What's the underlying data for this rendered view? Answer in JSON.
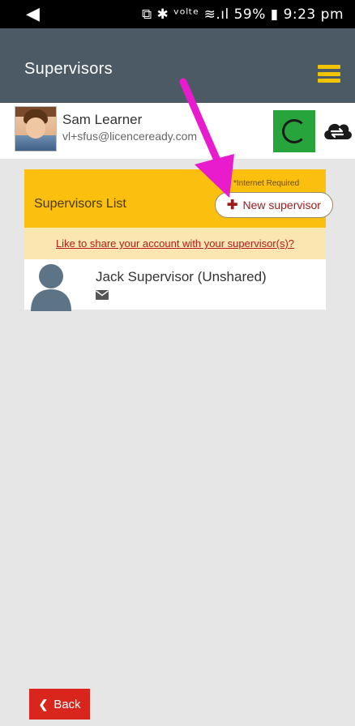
{
  "status_bar": {
    "back_glyph": "◀",
    "text": "⧉ ✱ ᵛᵒˡᵗᵉ ≋.ıl 59% ▮ 9:23 pm"
  },
  "header": {
    "title": "Supervisors"
  },
  "user": {
    "name": "Sam Learner",
    "email": "vl+sfus@licenceready.com"
  },
  "supervisors_panel": {
    "title": "Supervisors List",
    "internet_required": "*Internet Required",
    "new_button_label": "New supervisor",
    "share_link": "Like to share your account with your supervisor(s)?",
    "items": [
      {
        "name": "Jack Supervisor (Unshared)"
      }
    ]
  },
  "footer": {
    "back_label": "Back"
  },
  "colors": {
    "header_bg": "#4c5a66",
    "accent_yellow": "#fbbf10",
    "share_bg": "#fbe6b2",
    "back_red": "#d9261c",
    "sync_green": "#27a43c",
    "annotation_magenta": "#e81ccc"
  },
  "icons": [
    "back-arrow-icon",
    "menu-icon",
    "spinner-icon",
    "cloud-sync-icon",
    "plus-icon",
    "person-icon",
    "mail-icon",
    "chevron-left-icon"
  ]
}
